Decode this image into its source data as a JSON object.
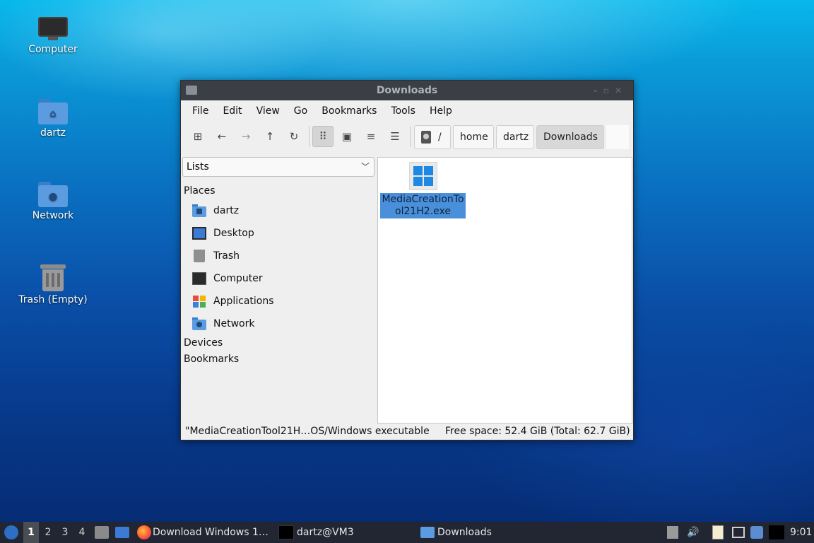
{
  "desktop": {
    "icons": [
      {
        "label": "Computer"
      },
      {
        "label": "dartz"
      },
      {
        "label": "Network"
      },
      {
        "label": "Trash (Empty)"
      }
    ]
  },
  "window": {
    "title": "Downloads",
    "menu": [
      "File",
      "Edit",
      "View",
      "Go",
      "Bookmarks",
      "Tools",
      "Help"
    ],
    "breadcrumbs": [
      "/",
      "home",
      "dartz",
      "Downloads"
    ],
    "side_dropdown": "Lists",
    "sections": {
      "places": "Places",
      "devices": "Devices",
      "bookmarks": "Bookmarks"
    },
    "places": [
      {
        "label": "dartz",
        "icon": "home-folder-icon"
      },
      {
        "label": "Desktop",
        "icon": "desktop-icon"
      },
      {
        "label": "Trash",
        "icon": "trash-icon"
      },
      {
        "label": "Computer",
        "icon": "computer-icon"
      },
      {
        "label": "Applications",
        "icon": "applications-icon"
      },
      {
        "label": "Network",
        "icon": "network-folder-icon"
      }
    ],
    "files": [
      {
        "name": "MediaCreationTool21H2.exe",
        "label_line1": "MediaCreationTo",
        "label_line2": "ol21H2.exe",
        "selected": true
      }
    ],
    "status_left": "\"MediaCreationTool21H…OS/Windows executable",
    "status_right": "Free space: 52.4 GiB (Total: 62.7 GiB)"
  },
  "taskbar": {
    "workspaces": [
      "1",
      "2",
      "3",
      "4"
    ],
    "active_workspace": "1",
    "tasks": [
      "Download Windows 1…",
      "dartz@VM3",
      "Downloads"
    ],
    "clock": "9:01"
  },
  "colors": {
    "selection": "#4a8fd9",
    "titlebar": "#3b3e45",
    "panel": "#24262c"
  }
}
